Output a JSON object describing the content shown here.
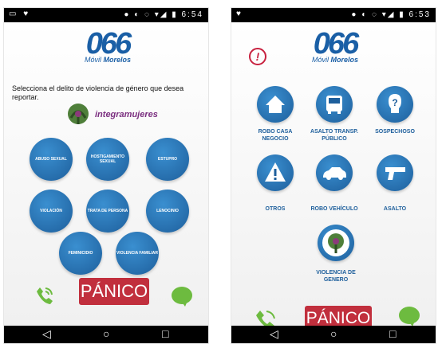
{
  "status_bar": {
    "left": {
      "left_icons": "▭ ♥",
      "time": "6:54"
    },
    "right": {
      "left_icons": "♥",
      "time": "6:53"
    },
    "status_icons": "● ◐ ◌ ▾◢ ▮"
  },
  "logo": {
    "number": "066",
    "brand_prefix": "Móvil",
    "brand_name": "Morelos"
  },
  "left_screen": {
    "prompt": "Selecciona el delito de violencia de género que desea reportar.",
    "partner_logo_text": "integramujeres",
    "options": [
      "ABUSO SEXUAL",
      "HOSTIGAMIENTO SEXUAL",
      "ESTUPRO",
      "VIOLACIÓN",
      "TRATA DE PERSONA",
      "LENOCINIO",
      "FEMINICIDIO",
      "VIOLENCIA FAMILIAR"
    ],
    "panic_label": "PÁNICO"
  },
  "right_screen": {
    "alert_symbol": "!",
    "options": [
      {
        "label": "ROBO CASA NEGOCIO",
        "icon": "house-icon"
      },
      {
        "label": "ASALTO TRANSP. PÚBLICO",
        "icon": "bus-icon"
      },
      {
        "label": "SOSPECHOSO",
        "icon": "suspect-icon"
      },
      {
        "label": "OTROS",
        "icon": "warning-icon"
      },
      {
        "label": "ROBO VEHÍCULO",
        "icon": "car-icon"
      },
      {
        "label": "ASALTO",
        "icon": "gun-icon"
      },
      {
        "label": "VIOLENCIA DE GENERO",
        "icon": "gender-violence-emblem-icon"
      }
    ],
    "panic_label": "PÁNICO"
  },
  "nav": {
    "back": "◁",
    "home": "○",
    "recent": "□"
  },
  "colors": {
    "accent_blue": "#1e5f9c",
    "panic_red": "#c12f3d",
    "green": "#6dbb3f",
    "brand_red": "#c8213f"
  }
}
